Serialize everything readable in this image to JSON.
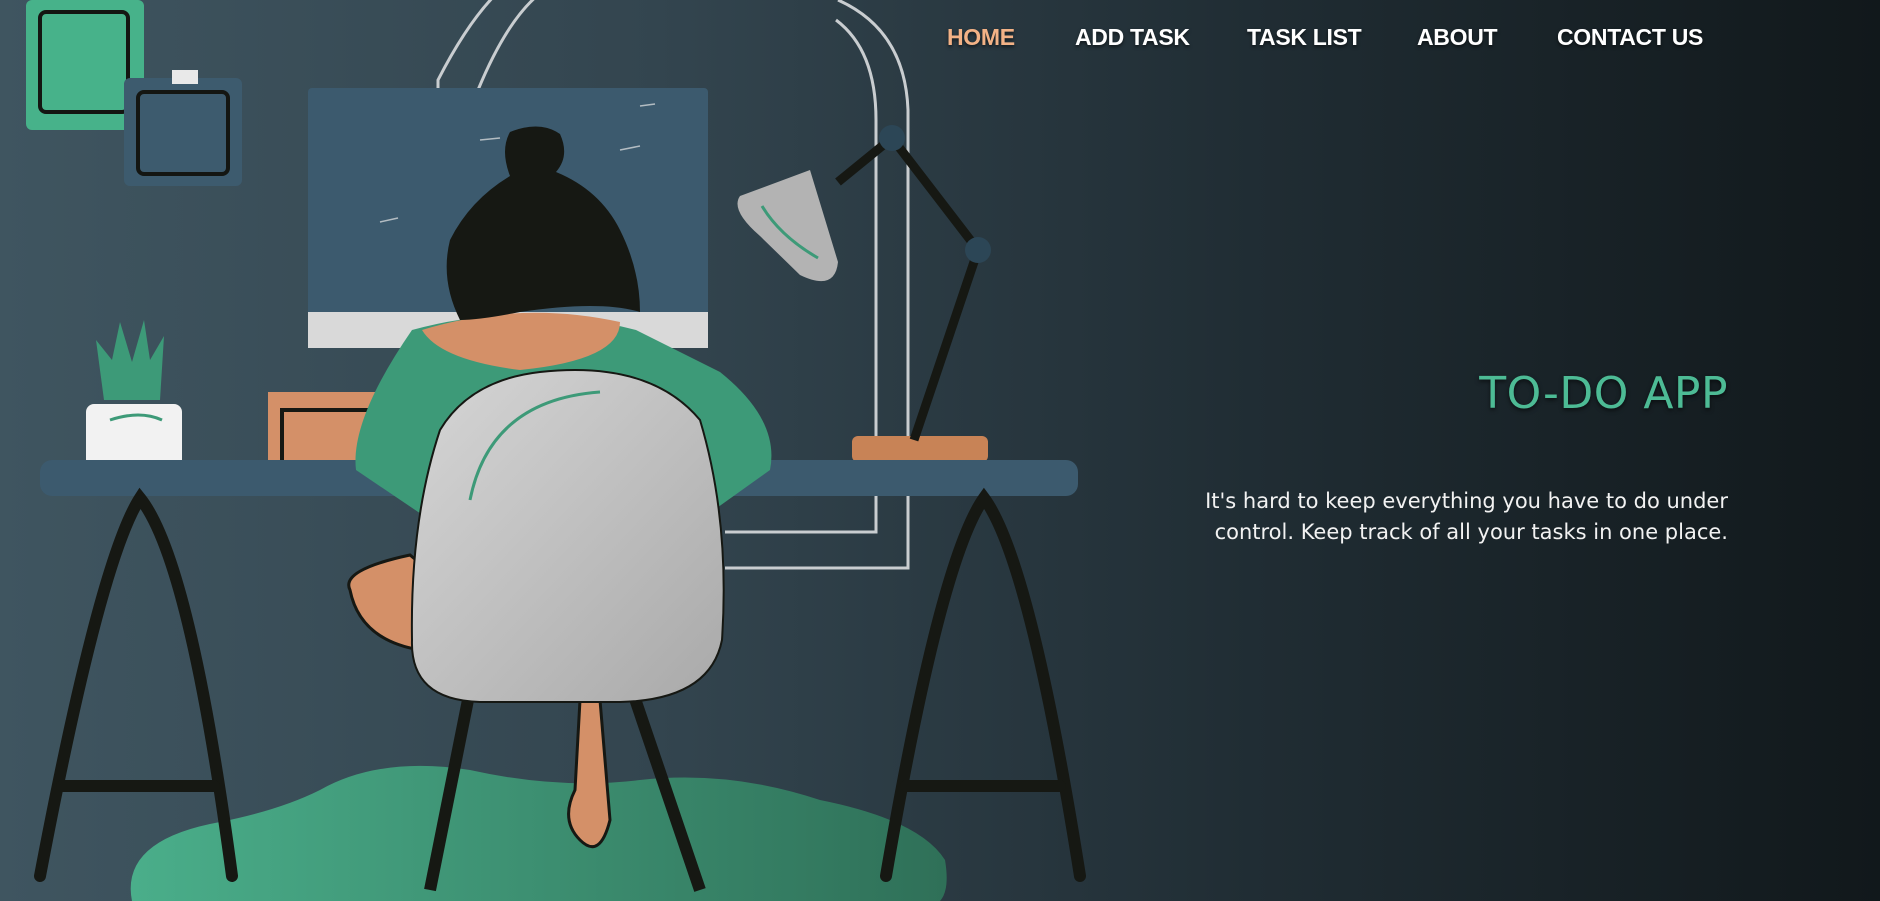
{
  "nav": {
    "items": [
      {
        "label": "HOME",
        "active": true
      },
      {
        "label": "ADD TASK",
        "active": false
      },
      {
        "label": "TASK LIST",
        "active": false
      },
      {
        "label": "ABOUT",
        "active": false
      },
      {
        "label": "CONTACT US",
        "active": false
      }
    ],
    "active_color": "#f3b286",
    "link_color": "#ffffff"
  },
  "hero": {
    "title": "TO-DO APP",
    "description": "It's hard to keep everything you have to do under control. Keep track of all your tasks in one place.",
    "title_color": "#4dbb95"
  },
  "illustration": {
    "icon": "woman-at-desk-illustration",
    "colors": {
      "green": "#3d9a78",
      "navy": "#3c5a6e",
      "skin": "#d49068",
      "dark": "#161813",
      "chair": "#c9c9c9"
    }
  }
}
